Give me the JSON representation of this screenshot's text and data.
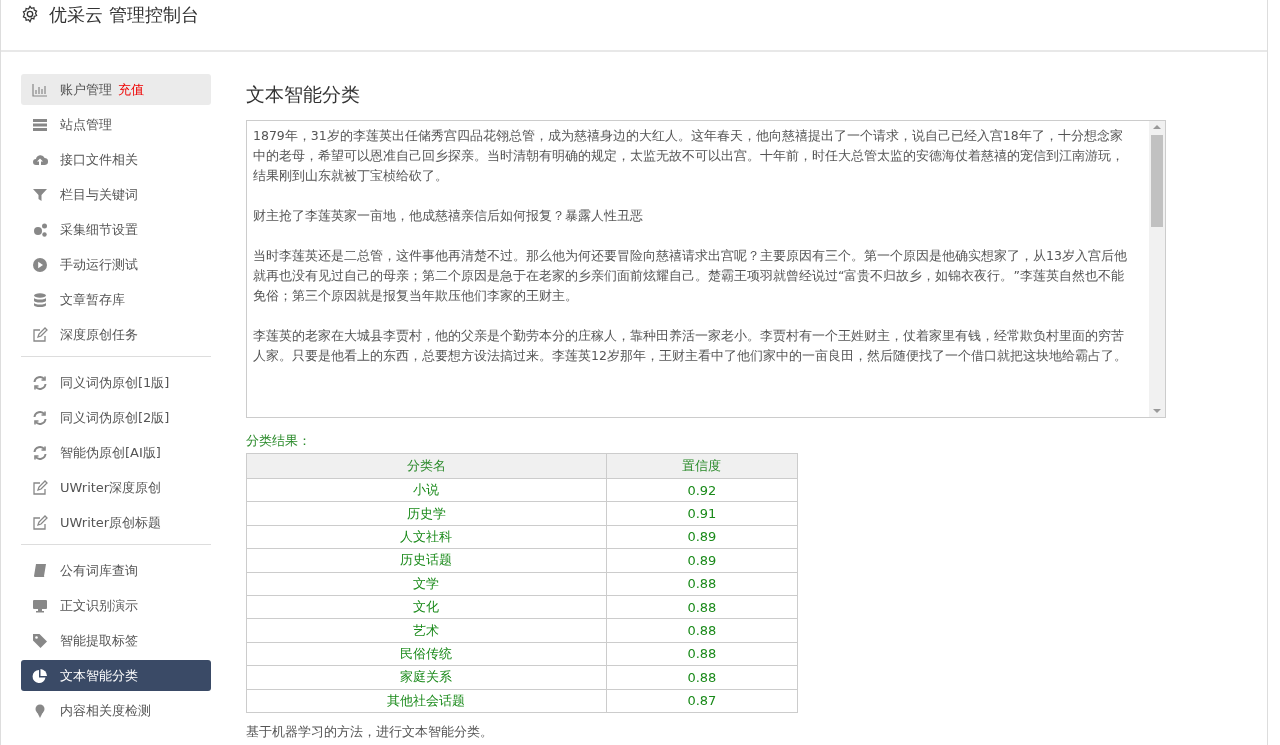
{
  "header": {
    "title": "优采云 管理控制台"
  },
  "sidebar": {
    "groups": [
      [
        {
          "label": "账户管理",
          "badge": "充值",
          "selected": false,
          "hover": true
        },
        {
          "label": "站点管理",
          "selected": false,
          "hover": false
        },
        {
          "label": "接口文件相关",
          "selected": false,
          "hover": false
        },
        {
          "label": "栏目与关键词",
          "selected": false,
          "hover": false
        },
        {
          "label": "采集细节设置",
          "selected": false,
          "hover": false
        },
        {
          "label": "手动运行测试",
          "selected": false,
          "hover": false
        },
        {
          "label": "文章暂存库",
          "selected": false,
          "hover": false
        },
        {
          "label": "深度原创任务",
          "selected": false,
          "hover": false
        }
      ],
      [
        {
          "label": "同义词伪原创[1版]",
          "selected": false,
          "hover": false
        },
        {
          "label": "同义词伪原创[2版]",
          "selected": false,
          "hover": false
        },
        {
          "label": "智能伪原创[AI版]",
          "selected": false,
          "hover": false
        },
        {
          "label": "UWriter深度原创",
          "selected": false,
          "hover": false
        },
        {
          "label": "UWriter原创标题",
          "selected": false,
          "hover": false
        }
      ],
      [
        {
          "label": "公有词库查询",
          "selected": false,
          "hover": false
        },
        {
          "label": "正文识别演示",
          "selected": false,
          "hover": false
        },
        {
          "label": "智能提取标签",
          "selected": false,
          "hover": false
        },
        {
          "label": "文本智能分类",
          "selected": true,
          "hover": false
        },
        {
          "label": "内容相关度检测",
          "selected": false,
          "hover": false
        }
      ]
    ]
  },
  "main": {
    "title": "文本智能分类",
    "text": [
      "1879年，31岁的李莲英出任储秀宫四品花翎总管，成为慈禧身边的大红人。这年春天，他向慈禧提出了一个请求，说自己已经入宫18年了，十分想念家中的老母，希望可以恩准自己回乡探亲。当时清朝有明确的规定，太监无故不可以出宫。十年前，时任大总管太监的安德海仗着慈禧的宠信到江南游玩，结果刚到山东就被丁宝桢给砍了。",
      "财主抢了李莲英家一亩地，他成慈禧亲信后如何报复？暴露人性丑恶",
      "当时李莲英还是二总管，这件事他再清楚不过。那么他为何还要冒险向慈禧请求出宫呢？主要原因有三个。第一个原因是他确实想家了，从13岁入宫后他就再也没有见过自己的母亲；第二个原因是急于在老家的乡亲们面前炫耀自己。楚霸王项羽就曾经说过“富贵不归故乡，如锦衣夜行。”李莲英自然也不能免俗；第三个原因就是报复当年欺压他们李家的王财主。",
      "李莲英的老家在大城县李贾村，他的父亲是个勤劳本分的庄稼人，靠种田养活一家老小。李贾村有一个王姓财主，仗着家里有钱，经常欺负村里面的穷苦人家。只要是他看上的东西，总要想方设法搞过来。李莲英12岁那年，王财主看中了他们家中的一亩良田，然后随便找了一个借口就把这块地给霸占了。"
    ],
    "result_label": "分类结果：",
    "table": {
      "columns": [
        "分类名",
        "置信度"
      ],
      "rows": [
        [
          "小说",
          "0.92"
        ],
        [
          "历史学",
          "0.91"
        ],
        [
          "人文社科",
          "0.89"
        ],
        [
          "历史话题",
          "0.89"
        ],
        [
          "文学",
          "0.88"
        ],
        [
          "文化",
          "0.88"
        ],
        [
          "艺术",
          "0.88"
        ],
        [
          "民俗传统",
          "0.88"
        ],
        [
          "家庭关系",
          "0.88"
        ],
        [
          "其他社会话题",
          "0.87"
        ]
      ]
    },
    "note": "基于机器学习的方法，进行文本智能分类。"
  }
}
